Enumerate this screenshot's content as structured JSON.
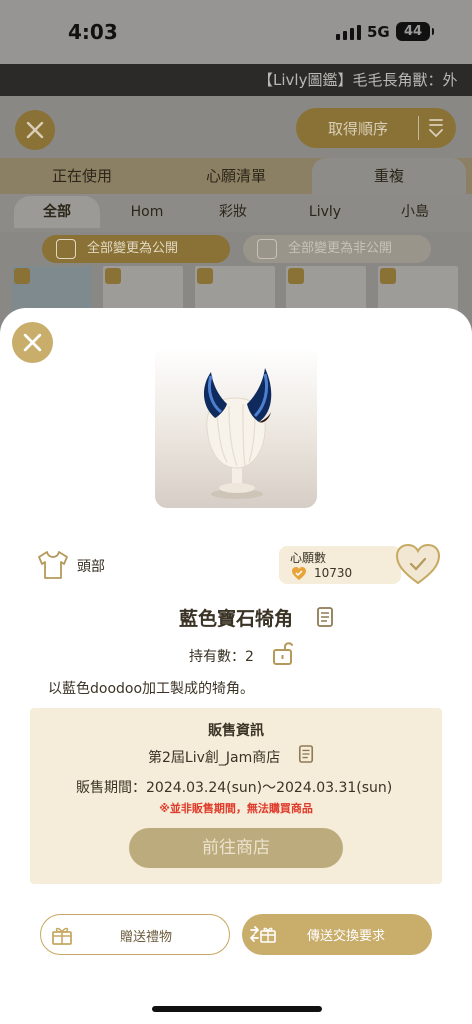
{
  "status_bar": {
    "time": "4:03",
    "network": "5G",
    "battery": "44"
  },
  "ticker": {
    "text": "【Livly圖鑑】毛毛長角獸：外"
  },
  "background": {
    "sort_label": "取得順序",
    "tabs": [
      "正在使用",
      "心願清單",
      "重複"
    ],
    "active_tab": "重複",
    "subtabs": [
      "全部",
      "Hom",
      "彩妝",
      "Livly",
      "小島"
    ],
    "active_subtab": "全部",
    "make_public_label": "全部變更為公開",
    "make_private_label": "全部變更為非公開"
  },
  "item": {
    "category": "頭部",
    "wishlist_label": "心願數",
    "wishlist_count": "10730",
    "name": "藍色寶石犄角",
    "owned": "持有數：2",
    "description": "以藍色doodoo加工製成的犄角。"
  },
  "sale_info": {
    "title": "販售資訊",
    "shop": "第2屆Liv創_Jam商店",
    "period": "販售期間：2024.03.24(sun)～2024.03.31(sun)",
    "warning": "※並非販售期間，無法購買商品",
    "goto_shop_label": "前往商店"
  },
  "actions": {
    "gift_label": "贈送禮物",
    "trade_label": "傳送交換要求"
  },
  "colors": {
    "accent_gold": "#c9ad6b",
    "sale_box_bg": "#f5ecd9",
    "warning_red": "#e03a2a",
    "disabled_button": "#bcab7c"
  }
}
